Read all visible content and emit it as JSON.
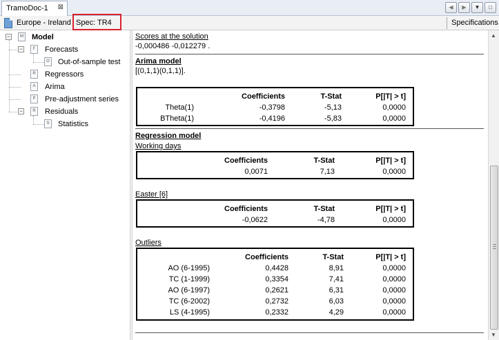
{
  "window": {
    "tab_title": "TramoDoc-1",
    "close_glyph": "⊠"
  },
  "nav": {
    "prev": "◀",
    "next": "▶",
    "menu": "▼",
    "restore": "□"
  },
  "infobar": {
    "series": "Europe - Ireland",
    "spec": "Spec: TR4",
    "specifications_label": "Specifications",
    "highlight_color": "#d8202e"
  },
  "tree": {
    "items": [
      {
        "label": "Model",
        "icon": "M",
        "expander": "−"
      },
      {
        "label": "Forecasts",
        "icon": "F",
        "expander": "−"
      },
      {
        "label": "Out-of-sample test",
        "icon": "O"
      },
      {
        "label": "Regressors",
        "icon": "R"
      },
      {
        "label": "Arima",
        "icon": "A"
      },
      {
        "label": "Pre-adjustment series",
        "icon": "P"
      },
      {
        "label": "Residuals",
        "icon": "R",
        "expander": "−"
      },
      {
        "label": "Statistics",
        "icon": "S"
      }
    ]
  },
  "content": {
    "scores_title": "Scores at the solution",
    "scores_values": "-0,000486 -0,012279 .",
    "arima_title": "Arima model",
    "arima_spec": "[(0,1,1)(0,1,1)].",
    "arima_table": {
      "headers": [
        "",
        "Coefficients",
        "T-Stat",
        "P[|T| > t]"
      ],
      "rows": [
        [
          "Theta(1)",
          "-0,3798",
          "-5,13",
          "0,0000"
        ],
        [
          "BTheta(1)",
          "-0,4196",
          "-5,83",
          "0,0000"
        ]
      ]
    },
    "regression_title": "Regression model",
    "working_days_title": "Working days",
    "working_days_table": {
      "headers": [
        "",
        "Coefficients",
        "T-Stat",
        "P[|T| > t]"
      ],
      "rows": [
        [
          "",
          "0,0071",
          "7,13",
          "0,0000"
        ]
      ]
    },
    "easter_title": "Easter [6]",
    "easter_table": {
      "headers": [
        "",
        "Coefficients",
        "T-Stat",
        "P[|T| > t]"
      ],
      "rows": [
        [
          "",
          "-0,0622",
          "-4,78",
          "0,0000"
        ]
      ]
    },
    "outliers_title": "Outliers",
    "outliers_table": {
      "headers": [
        "",
        "Coefficients",
        "T-Stat",
        "P[|T| > t]"
      ],
      "rows": [
        [
          "AO (6-1995)",
          "0,4428",
          "8,91",
          "0,0000"
        ],
        [
          "TC (1-1999)",
          "0,3354",
          "7,41",
          "0,0000"
        ],
        [
          "AO (6-1997)",
          "0,2621",
          "6,31",
          "0,0000"
        ],
        [
          "TC (6-2002)",
          "0,2732",
          "6,03",
          "0,0000"
        ],
        [
          "LS (4-1995)",
          "0,2332",
          "4,29",
          "0,0000"
        ]
      ]
    }
  },
  "scrollbar": {
    "up": "▲",
    "down": "▼"
  }
}
